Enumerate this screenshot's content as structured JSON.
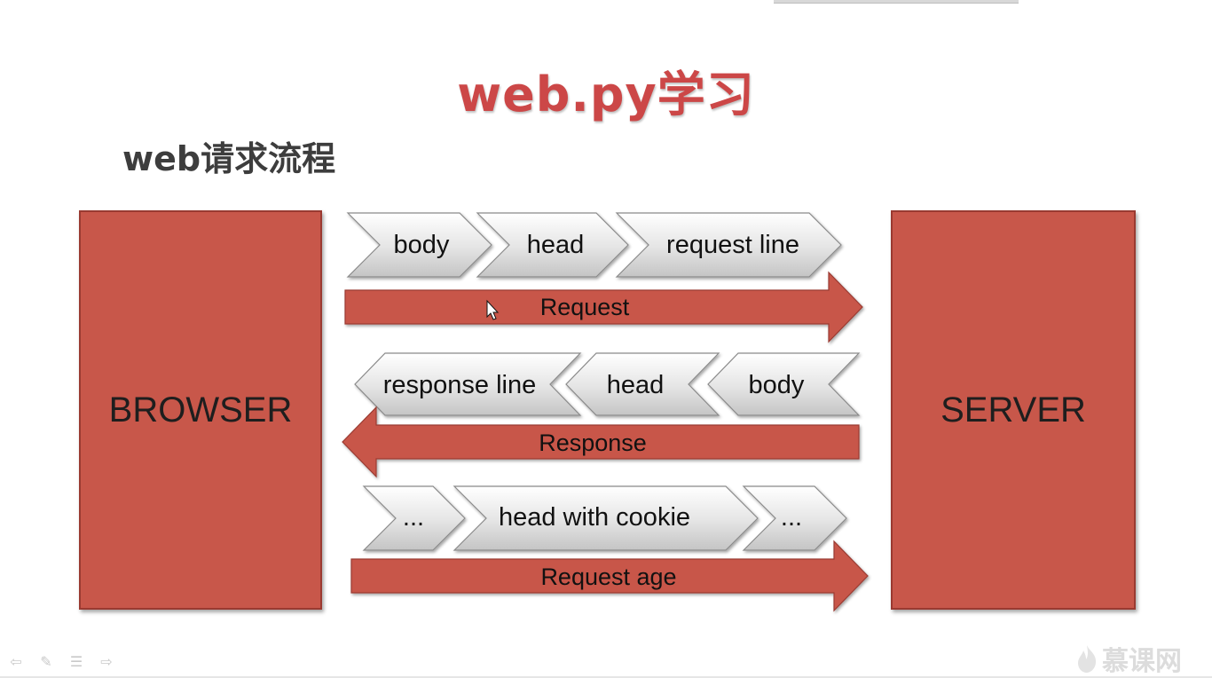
{
  "title": "web.py学习",
  "subtitle": "web请求流程",
  "browser_label": "BROWSER",
  "server_label": "SERVER",
  "rows": {
    "request": {
      "parts": [
        "body",
        "head",
        "request line"
      ],
      "arrow_label": "Request"
    },
    "response": {
      "parts": [
        "response line",
        "head",
        "body"
      ],
      "arrow_label": "Response"
    },
    "request_age": {
      "parts": [
        "...",
        "head with cookie",
        "..."
      ],
      "arrow_label": "Request age"
    }
  },
  "watermark": "慕课网",
  "colors": {
    "title": "#cc4747",
    "box": "#c8574a",
    "arrow": "#c8574a",
    "chevron": "#d8d8d8"
  }
}
